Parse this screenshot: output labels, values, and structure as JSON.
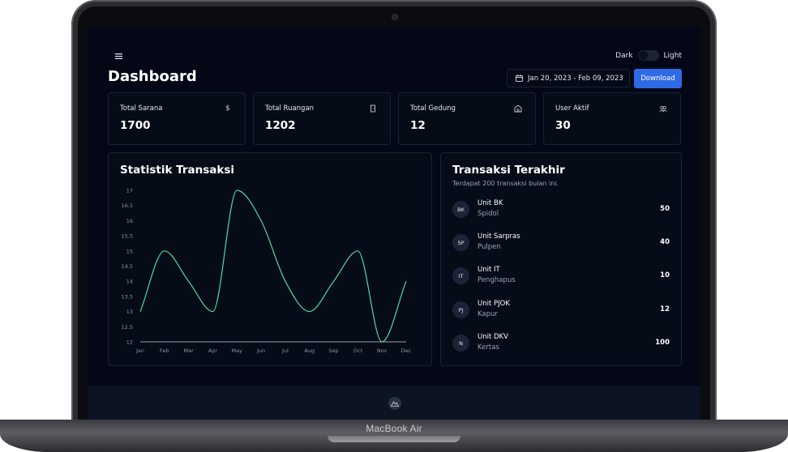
{
  "device": {
    "label": "MacBook Air"
  },
  "header": {
    "theme_dark_label": "Dark",
    "theme_light_label": "Light",
    "title": "Dashboard",
    "date_range": "Jan 20, 2023 - Feb 09, 2023",
    "download_label": "Download"
  },
  "stats": [
    {
      "label": "Total Sarana",
      "value": "1700",
      "icon": "dollar-icon"
    },
    {
      "label": "Total Ruangan",
      "value": "1202",
      "icon": "door-icon"
    },
    {
      "label": "Total Gedung",
      "value": "12",
      "icon": "building-icon"
    },
    {
      "label": "User Aktif",
      "value": "30",
      "icon": "users-icon"
    }
  ],
  "chart_section": {
    "title": "Statistik Transaksi"
  },
  "chart_data": {
    "type": "line",
    "title": "Statistik Transaksi",
    "categories": [
      "Jan",
      "Feb",
      "Mar",
      "Apr",
      "May",
      "Jun",
      "Jul",
      "Aug",
      "Sep",
      "Oct",
      "Nov",
      "Dec"
    ],
    "series": [
      {
        "values": [
          13,
          15,
          14,
          13,
          17,
          16,
          14,
          13,
          14,
          15,
          12,
          14
        ]
      }
    ],
    "ylim": [
      12,
      17
    ],
    "yticks": [
      "17",
      "16.5",
      "16",
      "15.5",
      "15",
      "14.5",
      "14",
      "13.5",
      "13",
      "12.5",
      "12"
    ],
    "line_color": "#4ade9e",
    "grid": false
  },
  "recent": {
    "title": "Transaksi Terakhir",
    "subtitle": "Terdapat 200 transaksi bulan ini.",
    "items": [
      {
        "initials": "BK",
        "name": "Unit BK",
        "item": "Spidol",
        "amount": "50"
      },
      {
        "initials": "SP",
        "name": "Unit Sarpras",
        "item": "Pulpen",
        "amount": "40"
      },
      {
        "initials": "IT",
        "name": "Unit IT",
        "item": "Penghapus",
        "amount": "10"
      },
      {
        "initials": "PJ",
        "name": "Unit PJOK",
        "item": "Kapur",
        "amount": "12"
      },
      {
        "initials": "N",
        "name": "Unit DKV",
        "item": "Kertas",
        "amount": "100"
      }
    ]
  }
}
